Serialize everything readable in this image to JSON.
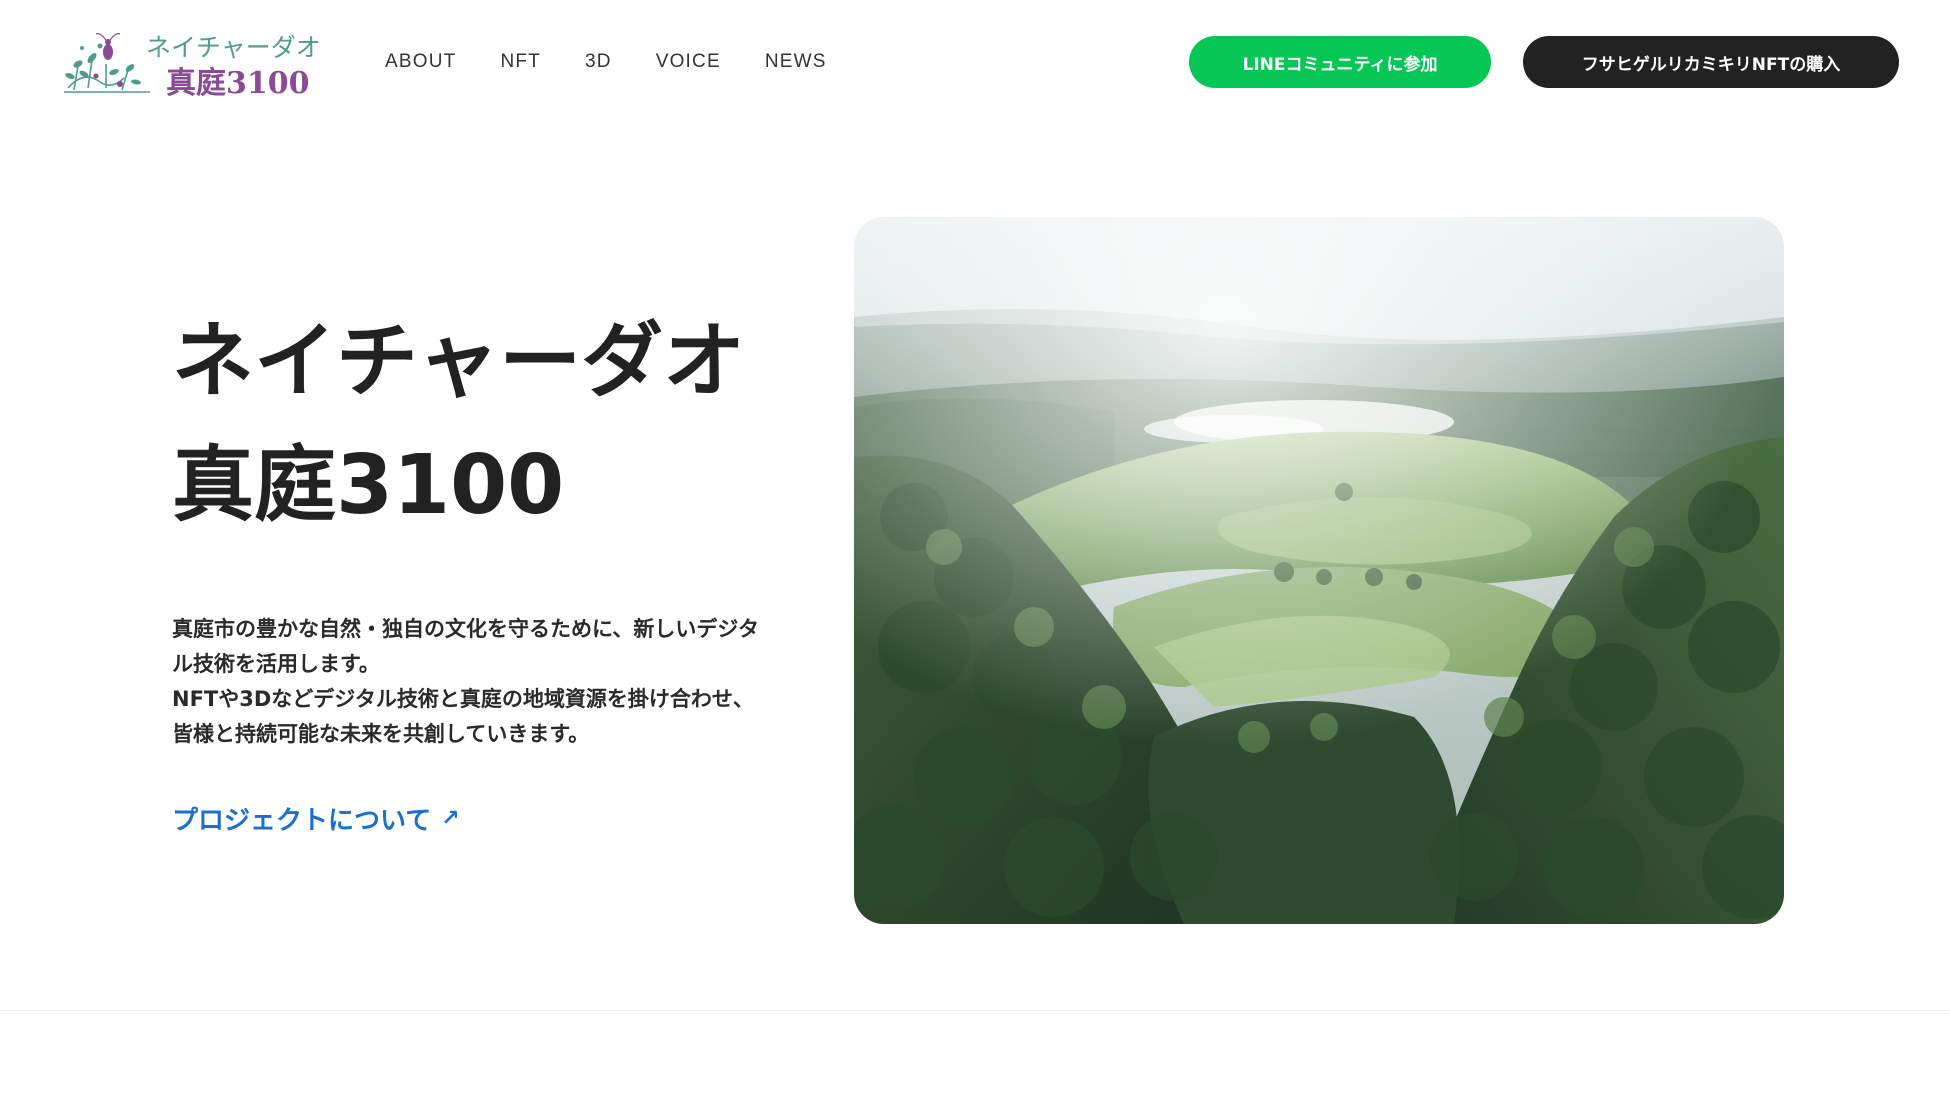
{
  "header": {
    "logo": {
      "line1": "ネイチャーダオ",
      "line2": "真庭3100",
      "icon": "wildflower-bug-logo-icon"
    },
    "nav": [
      "ABOUT",
      "NFT",
      "3D",
      "VOICE",
      "NEWS"
    ],
    "buttons": {
      "line_community": "LINEコミュニティに参加",
      "buy_nft": "フサヒゲルリカミキリNFTの購入"
    }
  },
  "hero": {
    "title_line1": "ネイチャーダオ",
    "title_line2": "真庭3100",
    "description": [
      "真庭市の豊かな自然・独自の文化を守るために、新しいデジタ",
      "ル技術を活用します。",
      "NFTや3Dなどデジタル技術と真庭の地域資源を掛け合わせ、",
      "皆様と持続可能な未来を共創していきます。"
    ],
    "link_label": "プロジェクトについて",
    "link_icon": "arrow-up-right-icon",
    "image": "aerial-forest-hills-photo"
  },
  "colors": {
    "line_green": "#06c755",
    "dark_button": "#222222",
    "link_blue": "#1a6fd6",
    "logo_teal": "#4f9c8e",
    "logo_purple": "#8a4a96"
  }
}
